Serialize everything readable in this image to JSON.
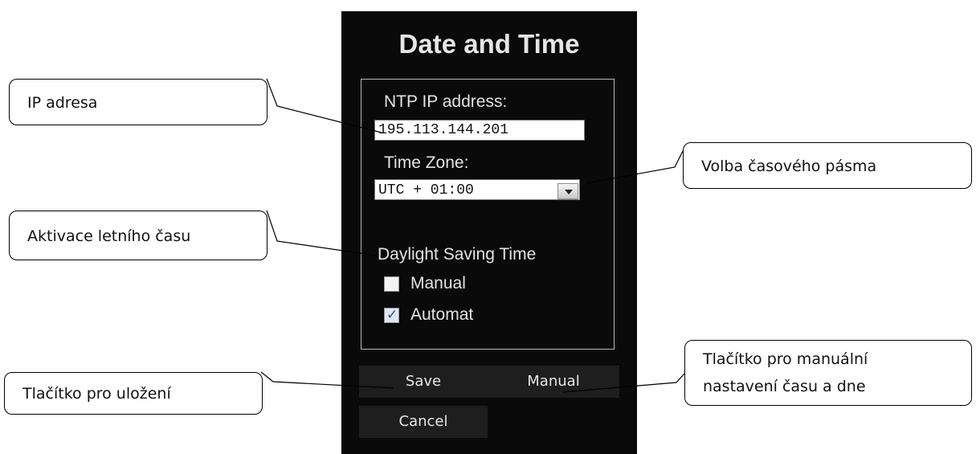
{
  "panel": {
    "title": "Date and Time",
    "ntp_label": "NTP IP address:",
    "ntp_value": "195.113.144.201",
    "timezone_label": "Time Zone:",
    "timezone_value": "UTC + 01:00",
    "dst_label": "Daylight Saving Time",
    "manual_option": {
      "label": "Manual",
      "checked": false
    },
    "automat_option": {
      "label": "Automat",
      "checked": true
    },
    "buttons": {
      "save": "Save",
      "manual": "Manual",
      "cancel": "Cancel"
    }
  },
  "callouts": {
    "ip": "IP adresa",
    "timezone": "Volba časového pásma",
    "dst": "Aktivace letního času",
    "save": "Tlačítko pro uložení",
    "manual_line1": "Tlačítko pro manuální",
    "manual_line2": "nastavení času a dne"
  },
  "icons": {
    "dropdown": "chevron-down-icon",
    "checkmark": "check-icon"
  }
}
